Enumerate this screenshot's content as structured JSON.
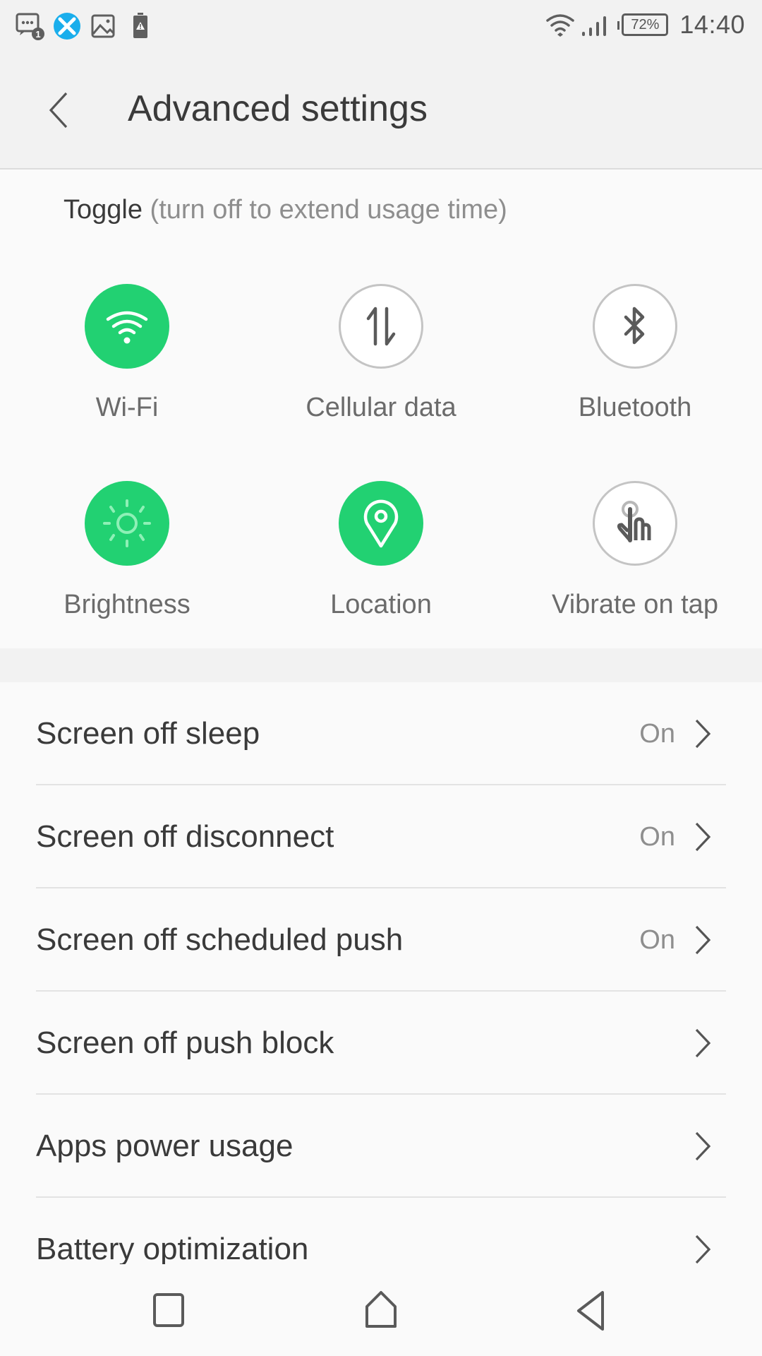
{
  "status_bar": {
    "left_icons": [
      "message-notification-icon",
      "xender-app-icon",
      "gallery-image-icon",
      "battery-warning-icon"
    ],
    "message_badge": "1",
    "right_icons": [
      "wifi-signal-icon",
      "cellular-signal-icon",
      "battery-icon"
    ],
    "battery_percent": "72%",
    "time": "14:40"
  },
  "app_bar": {
    "back_icon": "back-chevron-icon",
    "title": "Advanced settings"
  },
  "toggles": {
    "heading_strong": "Toggle",
    "heading_hint": "(turn off to extend usage time)",
    "accent_color": "#22d172",
    "items": [
      {
        "label": "Wi-Fi",
        "icon": "wifi-icon",
        "state": "on"
      },
      {
        "label": "Cellular data",
        "icon": "cellular-data-icon",
        "state": "off"
      },
      {
        "label": "Bluetooth",
        "icon": "bluetooth-icon",
        "state": "off"
      },
      {
        "label": "Brightness",
        "icon": "brightness-icon",
        "state": "on"
      },
      {
        "label": "Location",
        "icon": "location-pin-icon",
        "state": "on"
      },
      {
        "label": "Vibrate on tap",
        "icon": "tap-hand-icon",
        "state": "off"
      }
    ]
  },
  "settings": {
    "items": [
      {
        "label": "Screen off sleep",
        "value": "On"
      },
      {
        "label": "Screen off disconnect",
        "value": "On"
      },
      {
        "label": "Screen off scheduled push",
        "value": "On"
      },
      {
        "label": "Screen off push block",
        "value": ""
      },
      {
        "label": "Apps power usage",
        "value": ""
      },
      {
        "label": "Battery optimization",
        "value": ""
      }
    ]
  },
  "nav_bar": {
    "buttons": [
      "recents-icon",
      "home-icon",
      "back-icon"
    ]
  }
}
